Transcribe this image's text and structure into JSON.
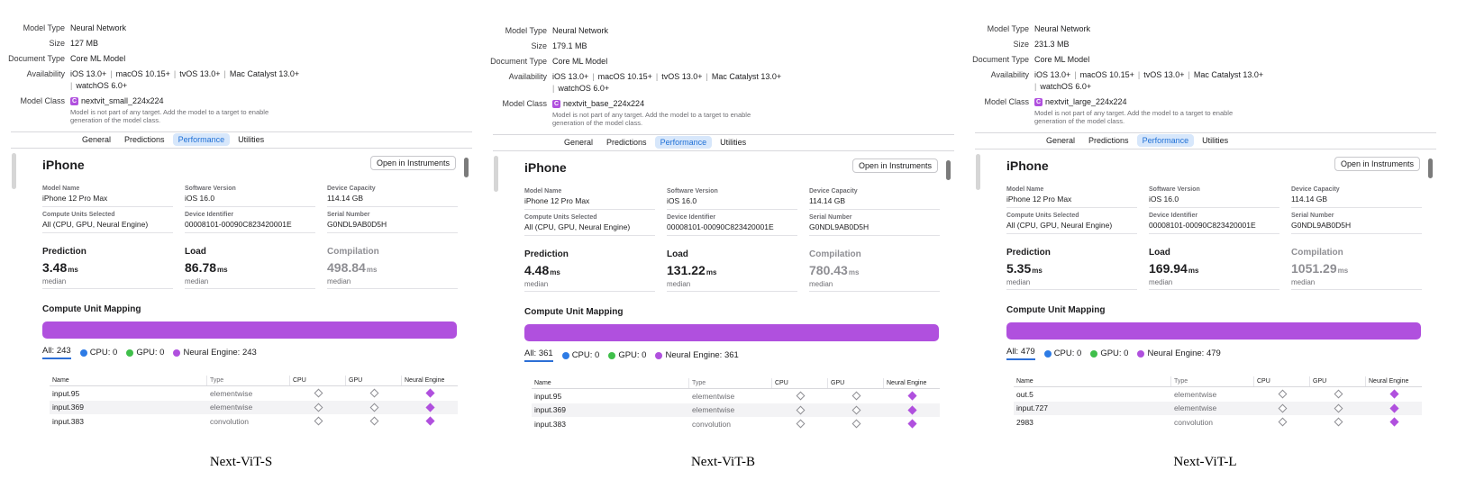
{
  "colors": {
    "neural_engine": "#b050de",
    "cpu": "#2d7be5",
    "gpu": "#3fbf4a",
    "accent": "#1f70d6"
  },
  "labels": {
    "model_type": "Model Type",
    "size": "Size",
    "document_type": "Document Type",
    "availability": "Availability",
    "model_class": "Model Class",
    "model_name": "Model Name",
    "software_version": "Software Version",
    "device_capacity": "Device Capacity",
    "compute_units": "Compute Units Selected",
    "device_identifier": "Device Identifier",
    "serial_number": "Serial Number",
    "prediction": "Prediction",
    "load": "Load",
    "compilation": "Compilation",
    "ms": "ms",
    "median": "median",
    "compute_unit_mapping": "Compute Unit Mapping",
    "col_name": "Name",
    "col_type": "Type",
    "col_cpu": "CPU",
    "col_gpu": "GPU",
    "col_ne": "Neural Engine",
    "open_instruments": "Open in Instruments"
  },
  "panels": [
    {
      "caption": "Next-ViT-S",
      "meta": {
        "model_type": "Neural Network",
        "size": "127 MB",
        "document_type": "Core ML Model",
        "availability": [
          "iOS 13.0+",
          "macOS 10.15+",
          "tvOS 13.0+",
          "Mac Catalyst 13.0+",
          "watchOS 6.0+"
        ],
        "model_class": "nextvit_small_224x224",
        "model_class_note": "Model is not part of any target. Add the model to a target to enable generation of the model class.",
        "model_class_icon": "C"
      },
      "tabs": [
        "General",
        "Predictions",
        "Performance",
        "Utilities"
      ],
      "active_tab": "Performance",
      "device": {
        "title": "iPhone",
        "model_name": "iPhone 12 Pro Max",
        "software_version": "iOS 16.0",
        "device_capacity": "114.14 GB",
        "compute_units": "All (CPU, GPU, Neural Engine)",
        "device_identifier": "00008101-00090C823420001E",
        "serial_number": "G0NDL9AB0D5H"
      },
      "metrics": {
        "prediction": "3.48",
        "load": "86.78",
        "compilation": "498.84"
      },
      "legend": {
        "all": "All: 243",
        "cpu": "CPU: 0",
        "gpu": "GPU: 0",
        "ne": "Neural Engine: 243"
      },
      "rows": [
        {
          "name": "input.95",
          "type": "elementwise"
        },
        {
          "name": "input.369",
          "type": "elementwise"
        },
        {
          "name": "input.383",
          "type": "convolution"
        }
      ]
    },
    {
      "caption": "Next-ViT-B",
      "meta": {
        "model_type": "Neural Network",
        "size": "179.1 MB",
        "document_type": "Core ML Model",
        "availability": [
          "iOS 13.0+",
          "macOS 10.15+",
          "tvOS 13.0+",
          "Mac Catalyst 13.0+",
          "watchOS 6.0+"
        ],
        "model_class": "nextvit_base_224x224",
        "model_class_note": "Model is not part of any target. Add the model to a target to enable generation of the model class.",
        "model_class_icon": "C"
      },
      "tabs": [
        "General",
        "Predictions",
        "Performance",
        "Utilities"
      ],
      "active_tab": "Performance",
      "device": {
        "title": "iPhone",
        "model_name": "iPhone 12 Pro Max",
        "software_version": "iOS 16.0",
        "device_capacity": "114.14 GB",
        "compute_units": "All (CPU, GPU, Neural Engine)",
        "device_identifier": "00008101-00090C823420001E",
        "serial_number": "G0NDL9AB0D5H"
      },
      "metrics": {
        "prediction": "4.48",
        "load": "131.22",
        "compilation": "780.43"
      },
      "legend": {
        "all": "All: 361",
        "cpu": "CPU: 0",
        "gpu": "GPU: 0",
        "ne": "Neural Engine: 361"
      },
      "rows": [
        {
          "name": "input.95",
          "type": "elementwise"
        },
        {
          "name": "input.369",
          "type": "elementwise"
        },
        {
          "name": "input.383",
          "type": "convolution"
        }
      ]
    },
    {
      "caption": "Next-ViT-L",
      "meta": {
        "model_type": "Neural Network",
        "size": "231.3 MB",
        "document_type": "Core ML Model",
        "availability": [
          "iOS 13.0+",
          "macOS 10.15+",
          "tvOS 13.0+",
          "Mac Catalyst 13.0+",
          "watchOS 6.0+"
        ],
        "model_class": "nextvit_large_224x224",
        "model_class_note": "Model is not part of any target. Add the model to a target to enable generation of the model class.",
        "model_class_icon": "C"
      },
      "tabs": [
        "General",
        "Predictions",
        "Performance",
        "Utilities"
      ],
      "active_tab": "Performance",
      "device": {
        "title": "iPhone",
        "model_name": "iPhone 12 Pro Max",
        "software_version": "iOS 16.0",
        "device_capacity": "114.14 GB",
        "compute_units": "All (CPU, GPU, Neural Engine)",
        "device_identifier": "00008101-00090C823420001E",
        "serial_number": "G0NDL9AB0D5H"
      },
      "metrics": {
        "prediction": "5.35",
        "load": "169.94",
        "compilation": "1051.29"
      },
      "legend": {
        "all": "All: 479",
        "cpu": "CPU: 0",
        "gpu": "GPU: 0",
        "ne": "Neural Engine: 479"
      },
      "rows": [
        {
          "name": "out.5",
          "type": "elementwise"
        },
        {
          "name": "input.727",
          "type": "elementwise"
        },
        {
          "name": "2983",
          "type": "convolution"
        }
      ]
    }
  ]
}
